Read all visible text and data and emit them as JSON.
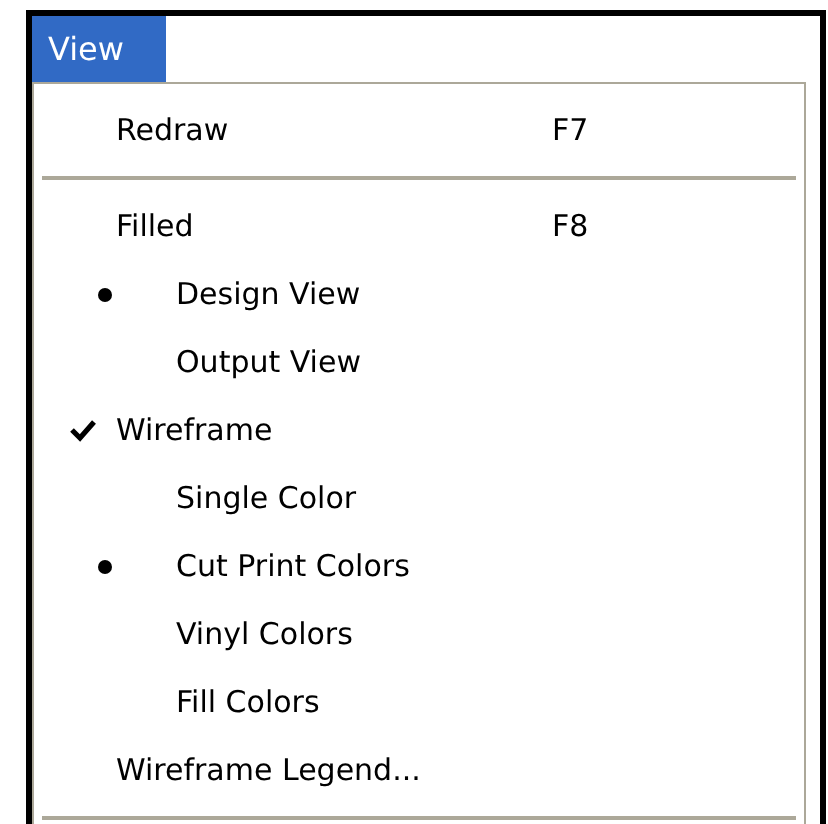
{
  "menu_bar": {
    "title": "View"
  },
  "menu": [
    {
      "kind": "item",
      "label": "Redraw",
      "shortcut": "F7",
      "checked": false
    },
    {
      "kind": "separator"
    },
    {
      "kind": "item",
      "label": "Filled",
      "shortcut": "F8",
      "checked": false,
      "children": [
        {
          "label": "Design View",
          "selected": true
        },
        {
          "label": "Output View",
          "selected": false
        }
      ]
    },
    {
      "kind": "item",
      "label": "Wireframe",
      "checked": true,
      "children": [
        {
          "label": "Single Color",
          "selected": false
        },
        {
          "label": "Cut Print Colors",
          "selected": true
        },
        {
          "label": "Vinyl Colors",
          "selected": false
        },
        {
          "label": "Fill Colors",
          "selected": false
        }
      ]
    },
    {
      "kind": "item",
      "label": "Wireframe Legend...",
      "checked": false
    },
    {
      "kind": "separator"
    }
  ]
}
